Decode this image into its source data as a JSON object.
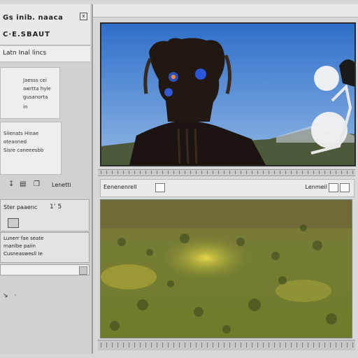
{
  "window": {
    "title_line1": "Gs inib. naaca",
    "title_line2": "C·E.SBAUT",
    "close_glyph": "x"
  },
  "sidebar": {
    "header": "Latn Inal lincs",
    "card1_lines": [
      "Jaesss cei",
      "awrtta hyle",
      "gusanorta",
      "in"
    ],
    "card2_lines": [
      "Siienats Hinae",
      "oteaoned",
      "Sisre caneeesbb"
    ],
    "toolbar_label": "Lenetti",
    "panel2_label": "Ster paaenc",
    "panel2_value": "1’ 5",
    "panel3_lines": [
      "Lunerr fae seate",
      "rnanlbe paiin",
      "Cusneaswesll Ie"
    ]
  },
  "viewer_top": {
    "sky_color": "#3a7fd4"
  },
  "viewer_toolbar": {
    "left_label": "Eenenenrell",
    "right_label": "Lenmeil"
  },
  "viewer_bottom": {
    "terrain_color": "#7c8a2e"
  }
}
